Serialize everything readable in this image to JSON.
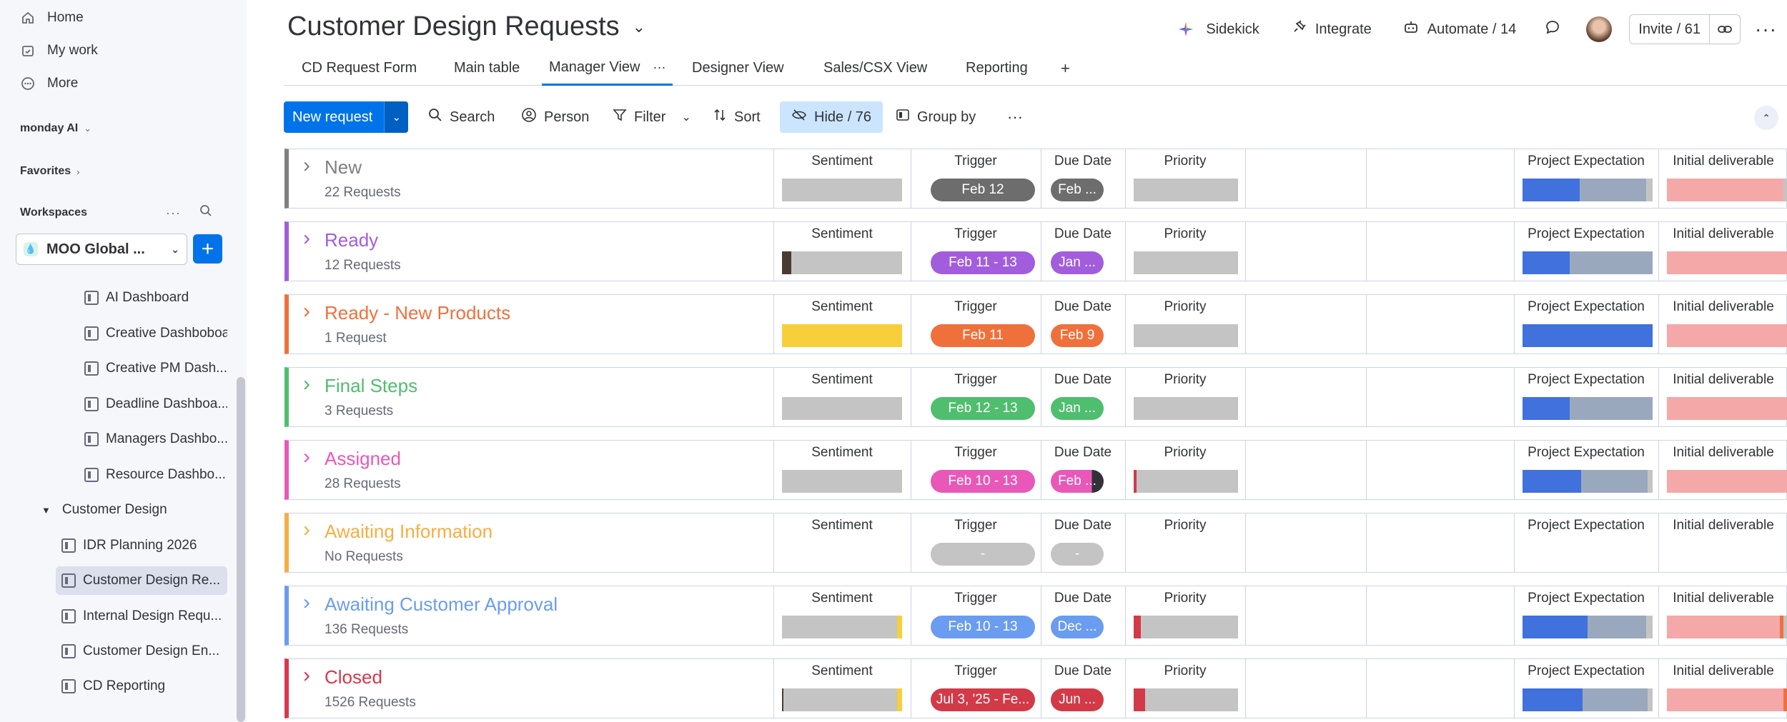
{
  "sidebar": {
    "top_items": [
      {
        "label": "Home",
        "icon": "home-icon"
      },
      {
        "label": "My work",
        "icon": "calendar-check-icon"
      },
      {
        "label": "More",
        "icon": "more-circle-icon"
      }
    ],
    "monday_ai": "monday AI",
    "favorites": "Favorites",
    "workspaces": "Workspaces",
    "workspace_name": "MOO Global ...",
    "dashboards": [
      "AI Dashboard",
      "Creative Dashboboa...",
      "Creative PM Dash...",
      "Deadline Dashboa...",
      "Managers Dashbo...",
      "Resource Dashbo..."
    ],
    "folder": "Customer Design",
    "boards": [
      "IDR Planning 2026",
      "Customer Design Re...",
      "Internal Design Requ...",
      "Customer Design En...",
      "CD Reporting"
    ]
  },
  "header": {
    "title": "Customer Design Requests",
    "sidekick": "Sidekick",
    "integrate": "Integrate",
    "automate": "Automate / 14",
    "invite": "Invite / 61"
  },
  "tabs": [
    "CD Request Form",
    "Main table",
    "Manager View",
    "Designer View",
    "Sales/CSX View",
    "Reporting"
  ],
  "toolbar": {
    "new_request": "New request",
    "search": "Search",
    "person": "Person",
    "filter": "Filter",
    "sort": "Sort",
    "hide": "Hide / 76",
    "group_by": "Group by"
  },
  "columns": {
    "sentiment": "Sentiment",
    "trigger": "Trigger",
    "due_date": "Due Date",
    "priority": "Priority",
    "project_expectation": "Project Expectation",
    "initial_deliverable": "Initial deliverable"
  },
  "colors": {
    "accent": "#0073ea",
    "bar_grey": "#c4c4c4",
    "pe_blue": "#4071dc",
    "pe_grey": "#9aa8bd",
    "deliverable_pink": "#f4a8a8"
  },
  "groups": [
    {
      "title": "New",
      "count": "22 Requests",
      "color": "#808080",
      "trigger": "Feb 12",
      "trigger_color": "#6d6d6d",
      "due": "Feb ...",
      "due_color": "#6d6d6d"
    },
    {
      "title": "Ready",
      "count": "12 Requests",
      "color": "#a25ddc",
      "trigger": "Feb 11 - 13",
      "trigger_color": "#a25ddc",
      "due": "Jan ...",
      "due_color": "#a25ddc"
    },
    {
      "title": "Ready - New Products",
      "count": "1 Request",
      "color": "#f0703c",
      "trigger": "Feb 11",
      "trigger_color": "#f0703c",
      "due": "Feb 9",
      "due_color": "#f0703c"
    },
    {
      "title": "Final Steps",
      "count": "3 Requests",
      "color": "#4fbe6e",
      "trigger": "Feb 12 - 13",
      "trigger_color": "#4fbe6e",
      "due": "Jan ...",
      "due_color": "#4fbe6e"
    },
    {
      "title": "Assigned",
      "count": "28 Requests",
      "color": "#e958b8",
      "trigger": "Feb 10 - 13",
      "trigger_color": "#e958b8",
      "due": "Feb ...",
      "due_color": "#e958b8"
    },
    {
      "title": "Awaiting Information",
      "count": "No Requests",
      "color": "#f6ad45",
      "trigger": "-",
      "trigger_color": "#c4c4c4",
      "due": "-",
      "due_color": "#c4c4c4"
    },
    {
      "title": "Awaiting Customer Approval",
      "count": "136 Requests",
      "color": "#6a9cf0",
      "trigger": "Feb 10 - 13",
      "trigger_color": "#6a9cf0",
      "due": "Dec ...",
      "due_color": "#6a9cf0"
    },
    {
      "title": "Closed",
      "count": "1526 Requests",
      "color": "#d9374c",
      "trigger": "Jul 3, '25 - Fe...",
      "trigger_color": "#d23a48",
      "due": "Jun ...",
      "due_color": "#d23a48"
    }
  ]
}
